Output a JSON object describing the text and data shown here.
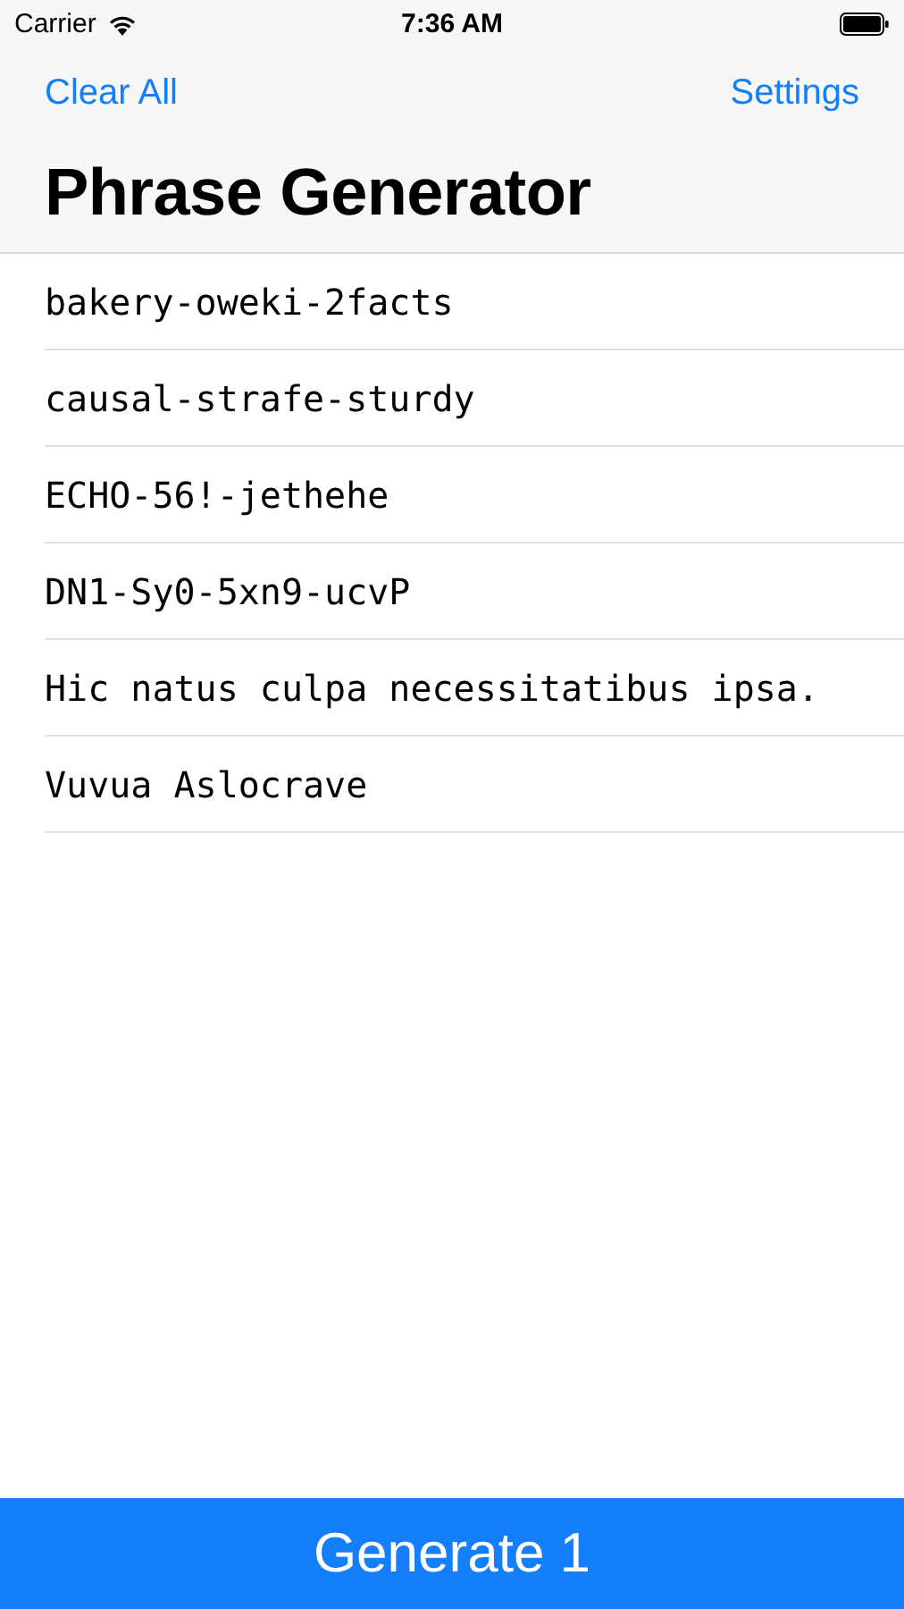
{
  "status_bar": {
    "carrier": "Carrier",
    "time": "7:36 AM"
  },
  "nav": {
    "left_button": "Clear All",
    "right_button": "Settings",
    "title": "Phrase Generator"
  },
  "phrases": [
    "bakery-oweki-2facts",
    "causal-strafe-sturdy",
    "ECHO-56!-jethehe",
    "DN1-Sy0-5xn9-ucvP",
    "Hic natus culpa necessitatibus ipsa.",
    "Vuvua Aslocrave"
  ],
  "generate_button": "Generate 1"
}
